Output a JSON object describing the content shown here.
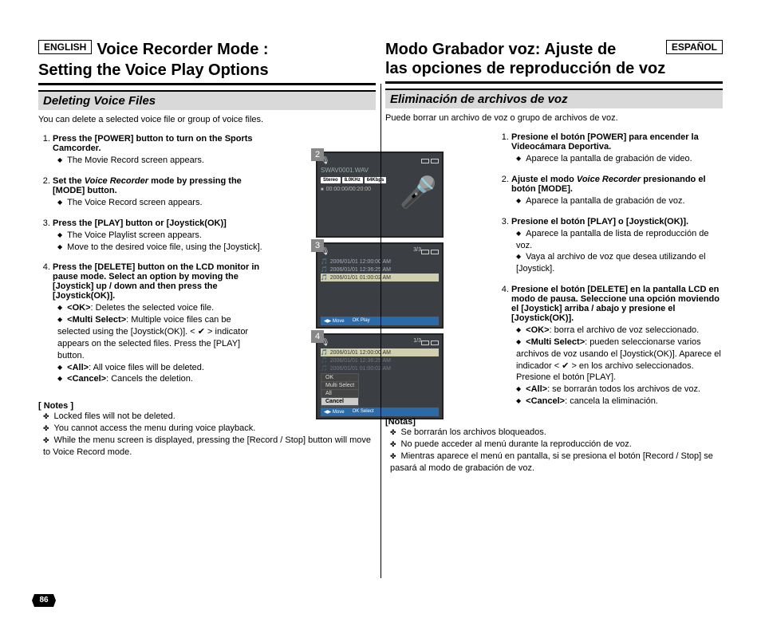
{
  "page_number": "86",
  "english": {
    "lang_badge": "ENGLISH",
    "title_line1": "Voice Recorder Mode :",
    "title_line2": "Setting the Voice Play Options",
    "subhead": "Deleting Voice Files",
    "intro": "You can delete a selected voice file or group of voice files.",
    "step1_title": "Press the [POWER] button to turn on the Sports Camcorder.",
    "step1_b1": "The Movie Record screen appears.",
    "step2_pre": "Set the ",
    "step2_mid": "Voice Recorder",
    "step2_post": " mode by pressing the [MODE] button.",
    "step2_b1": "The Voice Record screen appears.",
    "step3_title": "Press the [PLAY] button or [Joystick(OK)]",
    "step3_b1": "The Voice Playlist screen appears.",
    "step3_b2": "Move to the desired voice file, using the [Joystick].",
    "step4_title": "Press the [DELETE] button on the LCD monitor in pause mode. Select an option by moving the [Joystick] up / down and then press the [Joystick(OK)].",
    "step4_b1a": "<OK>",
    "step4_b1b": ": Deletes the selected voice file.",
    "step4_b2a": "<Multi Select>",
    "step4_b2b": ": Multiple voice files can be selected using the [Joystick(OK)]. < ✔ > indicator appears on the selected files. Press the [PLAY] button.",
    "step4_b3a": "<All>",
    "step4_b3b": ": All voice files will be deleted.",
    "step4_b4a": "<Cancel>",
    "step4_b4b": ": Cancels the deletion.",
    "notes_h": "[ Notes ]",
    "note1": "Locked files will not be deleted.",
    "note2": "You cannot access the menu during voice playback.",
    "note3": "While the menu screen is displayed, pressing the [Record / Stop] button will move to Voice  Record mode."
  },
  "spanish": {
    "lang_badge": "ESPAÑOL",
    "title_line1": "Modo Grabador voz: Ajuste de",
    "title_line2": "las opciones de reproducción de voz",
    "subhead": "Eliminación de archivos de voz",
    "intro": "Puede borrar un archivo de voz o grupo de archivos de voz.",
    "step1_title": "Presione el botón [POWER] para encender la Videocámara Deportiva.",
    "step1_b1": "Aparece la pantalla de grabación de video.",
    "step2_pre": "Ajuste el modo ",
    "step2_mid": "Voice Recorder",
    "step2_post": " presionando el botón [MODE].",
    "step2_b1": "Aparece la pantalla de grabación de voz.",
    "step3_title": "Presione el botón [PLAY] o [Joystick(OK)].",
    "step3_b1": "Aparece la pantalla de lista de reproducción de voz.",
    "step3_b2": "Vaya al archivo de voz que desea utilizando el [Joystick].",
    "step4_title": "Presione el botón [DELETE] en la pantalla LCD en modo de pausa. Seleccione una opción moviendo el [Joystick] arriba / abajo y presione el [Joystick(OK)].",
    "step4_b1a": "<OK>",
    "step4_b1b": ": borra el archivo de voz seleccionado.",
    "step4_b2a": "<Multi Select>",
    "step4_b2b": ": pueden seleccionarse varios archivos de voz usando el [Joystick(OK)]. Aparece el indicador < ✔ > en los archivo seleccionados. Presione el botón [PLAY].",
    "step4_b3a": "<All>",
    "step4_b3b": ": se borrarán todos los archivos de voz.",
    "step4_b4a": "<Cancel>",
    "step4_b4b": ": cancela la eliminación.",
    "notes_h": "[Notas]",
    "note1": "Se borrarán los archivos bloqueados.",
    "note2": "No puede acceder al menú durante la reproducción de voz.",
    "note3": "Mientras aparece el menú en pantalla, si se presiona el botón [Record / Stop] se pasará al modo de grabación de voz."
  },
  "lcd": {
    "n2": "2",
    "n3": "3",
    "n4": "4",
    "fname": "SWAV0001.WAV",
    "pill_stereo": "Stereo",
    "pill_rate": "8.0KHz",
    "pill_bitrate": "64Kbps",
    "timer": "00:00:00/00:20:00",
    "counter3": "3/3",
    "counter4": "1/3",
    "row1": "2006/01/01 12:00:00 AM",
    "row2": "2006/01/01 12:36:25 AM",
    "row3": "2006/01/01 01:00:02 AM",
    "footer_move": "Move",
    "footer_play": "Play",
    "footer_select": "Select",
    "menu_ok": "OK",
    "menu_multi": "Multi Select",
    "menu_all": "All",
    "menu_cancel": "Cancel"
  }
}
